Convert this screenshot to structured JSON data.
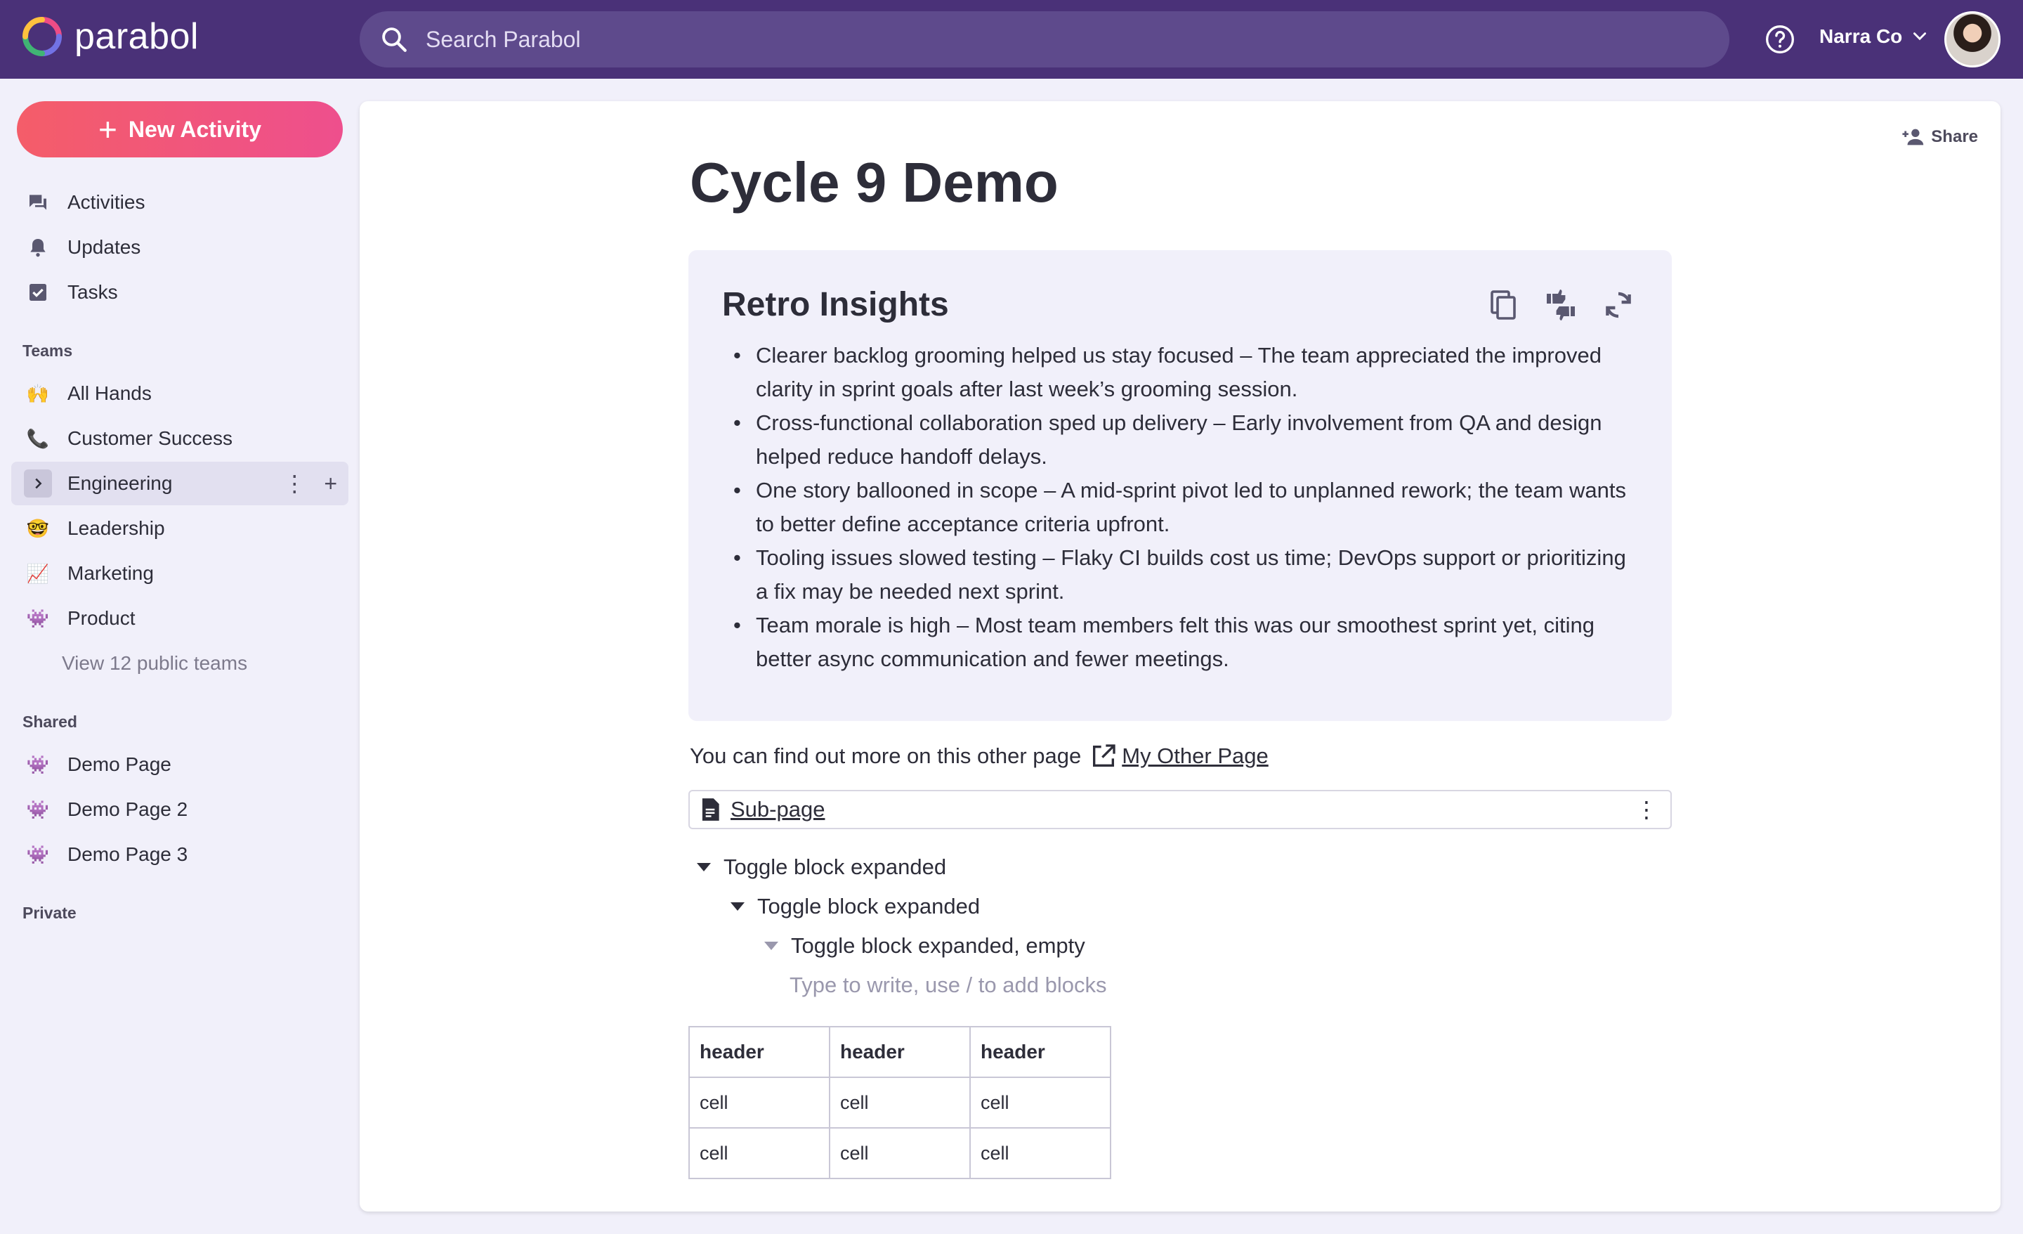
{
  "brand": {
    "name": "parabol"
  },
  "search": {
    "placeholder": "Search Parabol"
  },
  "header": {
    "org_name": "Narra Co"
  },
  "sidebar": {
    "new_activity_label": "New Activity",
    "main_items": [
      {
        "label": "Activities",
        "icon": "chat-icon"
      },
      {
        "label": "Updates",
        "icon": "bell-icon"
      },
      {
        "label": "Tasks",
        "icon": "checkbox-icon"
      }
    ],
    "teams_label": "Teams",
    "teams": [
      {
        "label": "All Hands",
        "emoji": "🙌"
      },
      {
        "label": "Customer Success",
        "emoji": "📞"
      },
      {
        "label": "Engineering",
        "icon": "chevron-right-icon",
        "active": true
      },
      {
        "label": "Leadership",
        "emoji": "🤓"
      },
      {
        "label": "Marketing",
        "emoji": "📈"
      },
      {
        "label": "Product",
        "emoji": "👾"
      }
    ],
    "view_public_teams": "View 12 public teams",
    "shared_label": "Shared",
    "shared": [
      {
        "label": "Demo Page",
        "emoji": "👾"
      },
      {
        "label": "Demo Page 2",
        "emoji": "👾"
      },
      {
        "label": "Demo Page 3",
        "emoji": "👾"
      }
    ],
    "private_label": "Private"
  },
  "main": {
    "share_label": "Share",
    "title": "Cycle 9 Demo",
    "insights": {
      "title": "Retro Insights",
      "items": [
        "Clearer backlog grooming helped us stay focused – The team appreciated the improved clarity in sprint goals after last week’s grooming session.",
        "Cross-functional collaboration sped up delivery – Early involvement from QA and design helped reduce handoff delays.",
        "One story ballooned in scope – A mid-sprint pivot led to unplanned rework; the team wants to better define acceptance criteria upfront.",
        "Tooling issues slowed testing – Flaky CI builds cost us time; DevOps support or prioritizing a fix may be needed next sprint.",
        "Team morale is high – Most team members felt this was our smoothest sprint yet, citing better async communication and fewer meetings."
      ]
    },
    "paragraph_text": "You can find out more on this other page",
    "paragraph_link": "My Other Page",
    "subpage_label": "Sub-page",
    "toggles": [
      "Toggle block expanded",
      "Toggle block expanded",
      "Toggle block expanded, empty"
    ],
    "block_placeholder": "Type to write, use / to add blocks",
    "table": {
      "headers": [
        "header",
        "header",
        "header"
      ],
      "rows": [
        [
          "cell",
          "cell",
          "cell"
        ],
        [
          "cell",
          "cell",
          "cell"
        ]
      ]
    }
  }
}
